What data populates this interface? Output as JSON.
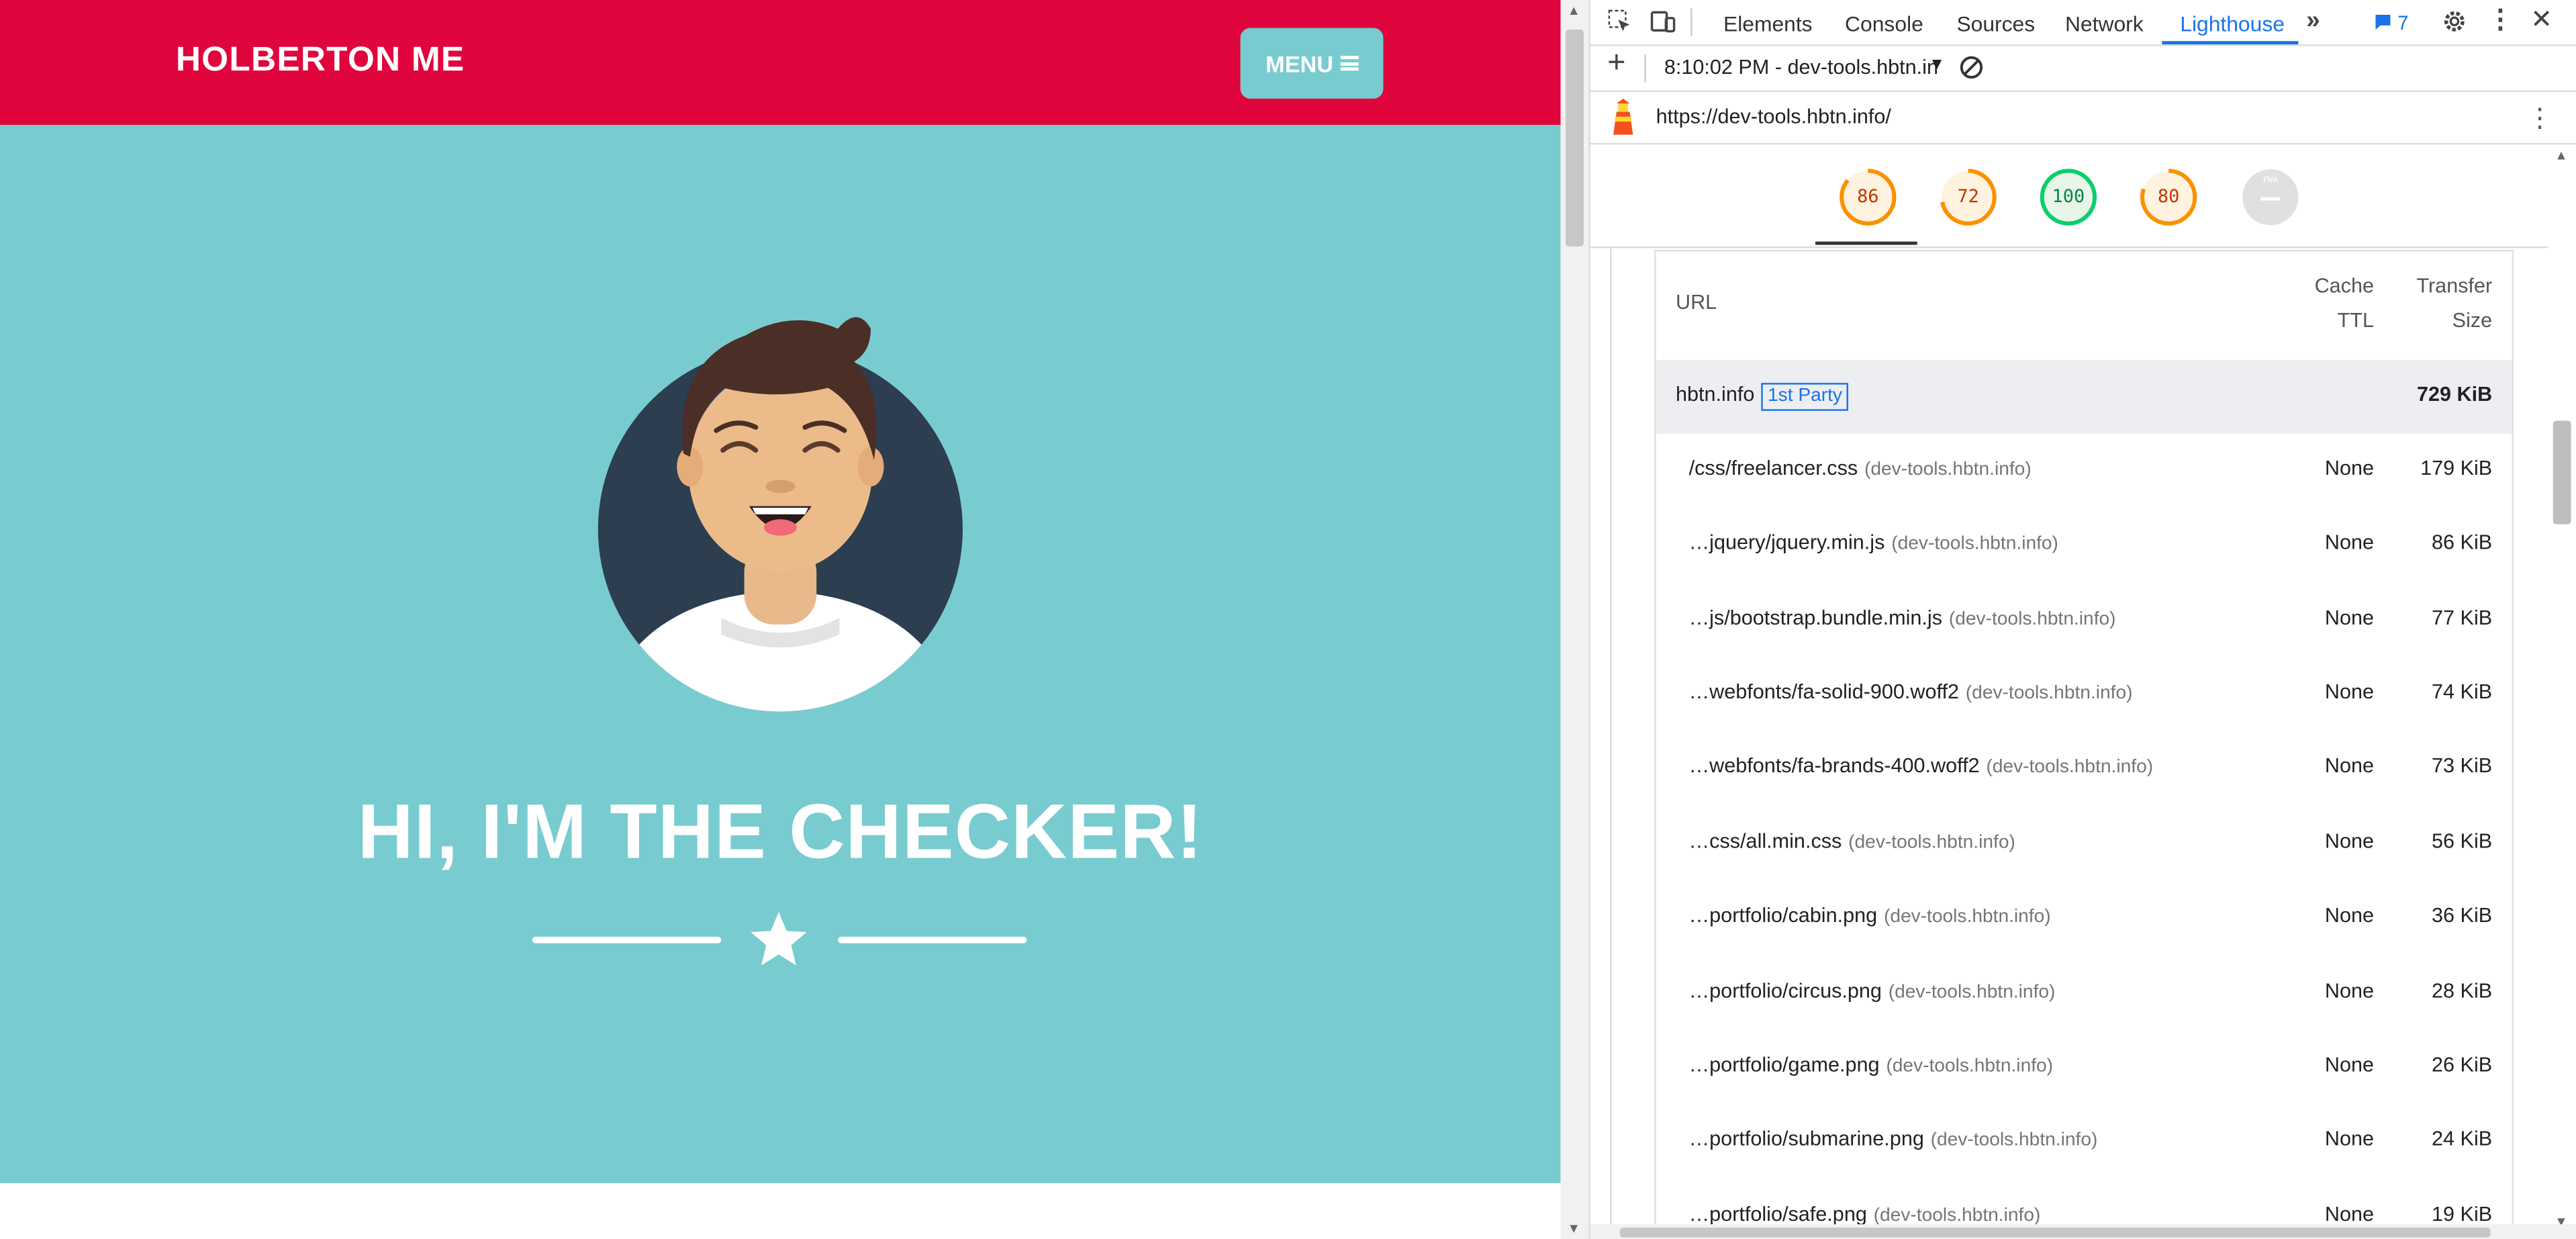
{
  "site": {
    "brand": "HOLBERTON ME",
    "menu_label": "MENU",
    "hero_title": "HI, I'M THE CHECKER!",
    "colors": {
      "nav": "#e0063d",
      "hero": "#78ccd0",
      "menu_button": "#78ccd0"
    }
  },
  "devtools": {
    "tabs": [
      "Elements",
      "Console",
      "Sources",
      "Network",
      "Lighthouse"
    ],
    "active_tab": "Lighthouse",
    "issues_count": "7",
    "report_time": "8:10:02 PM - dev-tools.hbtn.in",
    "url": "https://dev-tools.hbtn.info/",
    "scores": [
      {
        "value": "86",
        "color": "#fa9100"
      },
      {
        "value": "72",
        "color": "#fa9100"
      },
      {
        "value": "100",
        "color": "#0cce6b"
      },
      {
        "value": "80",
        "color": "#fa9100"
      },
      {
        "value": "PWA",
        "color": "#9e9e9e"
      }
    ],
    "table": {
      "headers": {
        "url": "URL",
        "ttl_1": "Cache",
        "ttl_2": "TTL",
        "size_1": "Transfer",
        "size_2": "Size"
      },
      "group": {
        "name": "hbtn.info",
        "badge": "1st Party",
        "size": "729 KiB"
      },
      "rows": [
        {
          "url": "/css/freelancer.css",
          "host": "(dev-tools.hbtn.info)",
          "ttl": "None",
          "size": "179 KiB"
        },
        {
          "url": "…jquery/jquery.min.js",
          "host": "(dev-tools.hbtn.info)",
          "ttl": "None",
          "size": "86 KiB"
        },
        {
          "url": "…js/bootstrap.bundle.min.js",
          "host": "(dev-tools.hbtn.info)",
          "ttl": "None",
          "size": "77 KiB"
        },
        {
          "url": "…webfonts/fa-solid-900.woff2",
          "host": "(dev-tools.hbtn.info)",
          "ttl": "None",
          "size": "74 KiB"
        },
        {
          "url": "…webfonts/fa-brands-400.woff2",
          "host": "(dev-tools.hbtn.info)",
          "ttl": "None",
          "size": "73 KiB"
        },
        {
          "url": "…css/all.min.css",
          "host": "(dev-tools.hbtn.info)",
          "ttl": "None",
          "size": "56 KiB"
        },
        {
          "url": "…portfolio/cabin.png",
          "host": "(dev-tools.hbtn.info)",
          "ttl": "None",
          "size": "36 KiB"
        },
        {
          "url": "…portfolio/circus.png",
          "host": "(dev-tools.hbtn.info)",
          "ttl": "None",
          "size": "28 KiB"
        },
        {
          "url": "…portfolio/game.png",
          "host": "(dev-tools.hbtn.info)",
          "ttl": "None",
          "size": "26 KiB"
        },
        {
          "url": "…portfolio/submarine.png",
          "host": "(dev-tools.hbtn.info)",
          "ttl": "None",
          "size": "24 KiB"
        },
        {
          "url": "…portfolio/safe.png",
          "host": "(dev-tools.hbtn.info)",
          "ttl": "None",
          "size": "19 KiB"
        }
      ]
    }
  }
}
